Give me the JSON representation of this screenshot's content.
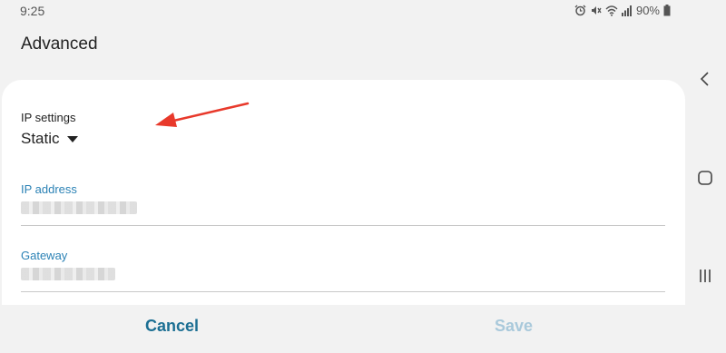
{
  "status_bar": {
    "time": "9:25",
    "battery": "90%",
    "icons": [
      "alarm-icon",
      "mute-icon",
      "wifi-icon",
      "signal-icon",
      "battery-icon"
    ]
  },
  "page": {
    "title": "Advanced"
  },
  "ip_settings": {
    "label": "IP settings",
    "selected": "Static"
  },
  "fields": [
    {
      "label": "IP address"
    },
    {
      "label": "Gateway"
    }
  ],
  "actions": {
    "cancel": "Cancel",
    "save": "Save"
  },
  "colors": {
    "accent": "#2b82b5",
    "cancel": "#1c6f93",
    "save_disabled": "#a9c9db",
    "annotation_arrow": "#e8392b"
  },
  "nav_bar": {
    "icons": [
      "back-icon",
      "home-icon",
      "recents-icon"
    ]
  }
}
